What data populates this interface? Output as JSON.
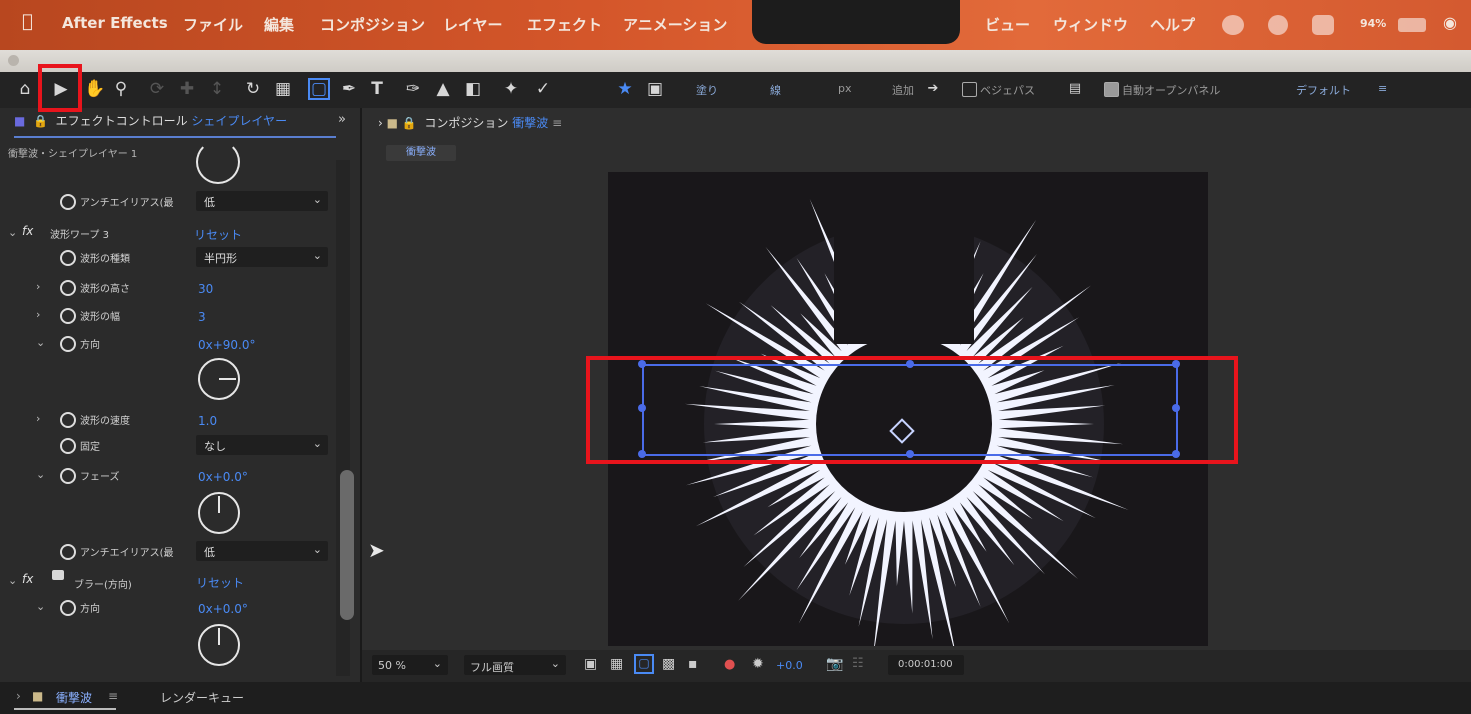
{
  "menubar": {
    "apple": "",
    "app": "After Effects",
    "file": "ファイル",
    "edit": "編集",
    "composition": "コンポジション",
    "layer": "レイヤー",
    "effect": "エフェクト",
    "animation": "アニメーション",
    "view": "ビュー",
    "window": "ウィンドウ",
    "help": "ヘルプ",
    "battery": "94%"
  },
  "toolbar": {
    "add_label": "追加",
    "bezier_label": "ベジェパス",
    "auto_open_label": "自動オープンパネル",
    "default_label": "デフォルト"
  },
  "effect_controls": {
    "tab_prefix": "エフェクトコントロール",
    "tab_layer": "シェイプレイヤー",
    "layer_path": "衝撃波・シェイプレイヤー 1",
    "rows": [
      {
        "label": "アンチエイリアス(最",
        "value": "低",
        "type": "dropdown"
      },
      {
        "label": "波形ワープ 3",
        "value": "リセット",
        "type": "effect"
      },
      {
        "label": "波形の種類",
        "value": "半円形",
        "type": "dropdown"
      },
      {
        "label": "波形の高さ",
        "value": "30",
        "type": "value"
      },
      {
        "label": "波形の幅",
        "value": "3",
        "type": "value"
      },
      {
        "label": "方向",
        "value": "0x+90.0°",
        "type": "value"
      },
      {
        "label": "波形の速度",
        "value": "1.0",
        "type": "value"
      },
      {
        "label": "固定",
        "value": "なし",
        "type": "dropdown"
      },
      {
        "label": "フェーズ",
        "value": "0x+0.0°",
        "type": "value"
      },
      {
        "label": "アンチエイリアス(最",
        "value": "低",
        "type": "dropdown"
      },
      {
        "label": "ブラー(方向)",
        "value": "リセット",
        "type": "effect"
      },
      {
        "label": "方向",
        "value": "0x+0.0°",
        "type": "value"
      }
    ]
  },
  "composition": {
    "tab_prefix": "コンポジション",
    "tab_name": "衝撃波",
    "chip": "衝撃波",
    "zoom": "50 %",
    "quality": "フル画質",
    "exposure": "+0.0",
    "timecode": "0:00:01:00"
  },
  "bottom": {
    "timeline_tab": "衝撃波",
    "render_queue": "レンダーキュー"
  },
  "colors": {
    "accent": "#4a8af4",
    "highlight": "#e8141c"
  }
}
